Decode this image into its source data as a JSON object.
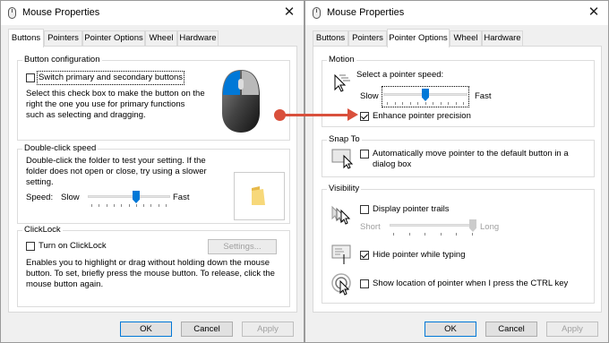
{
  "left": {
    "title": "Mouse Properties",
    "tabs": [
      "Buttons",
      "Pointers",
      "Pointer Options",
      "Wheel",
      "Hardware"
    ],
    "button_config": {
      "title": "Button configuration",
      "checkbox_label": "Switch primary and secondary buttons",
      "description": "Select this check box to make the button on the right the one you use for primary functions such as selecting and dragging."
    },
    "double_click": {
      "title": "Double-click speed",
      "description": "Double-click the folder to test your setting. If the folder does not open or close, try using a slower setting.",
      "speed_label": "Speed:",
      "slow": "Slow",
      "fast": "Fast",
      "value": 0.6
    },
    "clicklock": {
      "title": "ClickLock",
      "checkbox_label": "Turn on ClickLock",
      "settings_button": "Settings...",
      "description": "Enables you to highlight or drag without holding down the mouse button. To set, briefly press the mouse button. To release, click the mouse button again."
    },
    "buttons": {
      "ok": "OK",
      "cancel": "Cancel",
      "apply": "Apply"
    }
  },
  "right": {
    "title": "Mouse Properties",
    "tabs": [
      "Buttons",
      "Pointers",
      "Pointer Options",
      "Wheel",
      "Hardware"
    ],
    "motion": {
      "title": "Motion",
      "speed_label": "Select a pointer speed:",
      "slow": "Slow",
      "fast": "Fast",
      "value": 0.5,
      "precision_label": "Enhance pointer precision"
    },
    "snap": {
      "title": "Snap To",
      "label": "Automatically move pointer to the default button in a dialog box"
    },
    "visibility": {
      "title": "Visibility",
      "trails_label": "Display pointer trails",
      "short": "Short",
      "long": "Long",
      "trails_value": 1.0,
      "hide_label": "Hide pointer while typing",
      "show_label": "Show location of pointer when I press the CTRL key"
    },
    "buttons": {
      "ok": "OK",
      "cancel": "Cancel",
      "apply": "Apply"
    }
  },
  "colors": {
    "accent": "#0078d7",
    "arrow": "#d9503c"
  }
}
